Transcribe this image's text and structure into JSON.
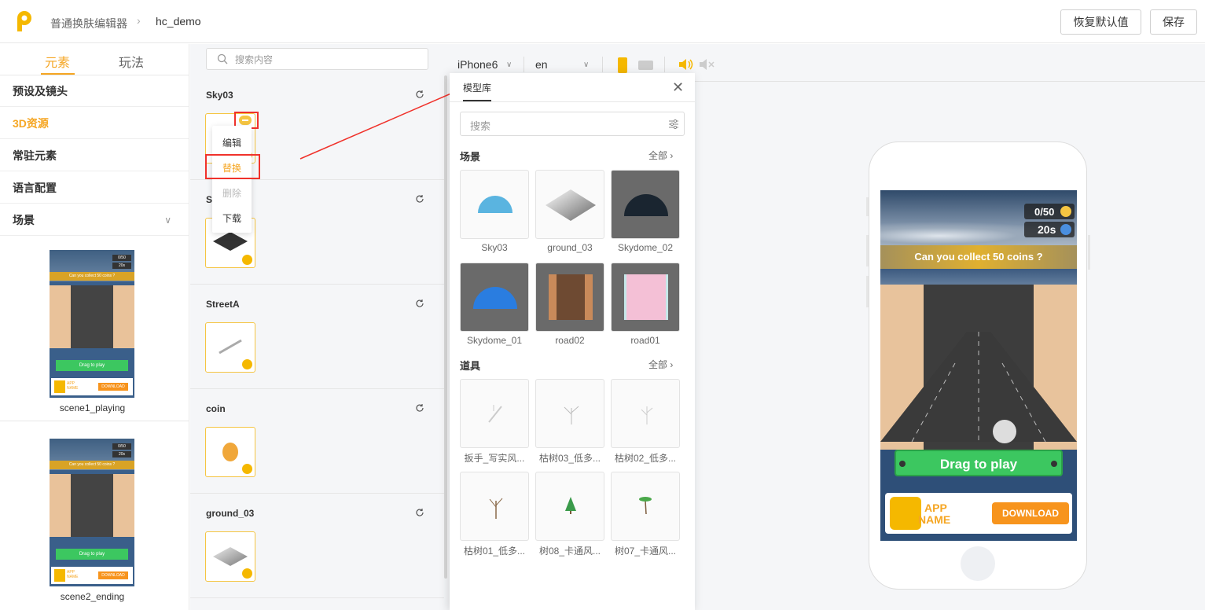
{
  "header": {
    "breadcrumb_root": "普通换肤编辑器",
    "breadcrumb_sep": "›",
    "project": "hc_demo",
    "reset_label": "恢复默认值",
    "save_label": "保存"
  },
  "left_nav": {
    "tabs": [
      "元素",
      "玩法"
    ],
    "items": [
      "预设及镜头",
      "3D资源",
      "常驻元素",
      "语言配置",
      "场景"
    ],
    "scenes": [
      "scene1_playing",
      "scene2_ending"
    ],
    "thumb_texts": {
      "score": "0/50",
      "time": "20s",
      "banner": "Can you collect 50 coins ?",
      "button": "Drag to play",
      "app": "APP NAME",
      "download": "DOWNLOAD"
    }
  },
  "asset_panel": {
    "search_placeholder": "搜索内容",
    "assets": [
      {
        "title": "Sky03"
      },
      {
        "title": "S"
      },
      {
        "title": "StreetA"
      },
      {
        "title": "coin"
      },
      {
        "title": "ground_03"
      }
    ],
    "context_menu": [
      "编辑",
      "替换",
      "删除",
      "下载"
    ]
  },
  "device_bar": {
    "device": "iPhone6",
    "language": "en"
  },
  "model_library": {
    "title": "模型库",
    "search_placeholder": "搜索",
    "scene_section": "场景",
    "prop_section": "道具",
    "all_label": "全部",
    "scene_items": [
      "Sky03",
      "ground_03",
      "Skydome_02",
      "Skydome_01",
      "road02",
      "road01"
    ],
    "prop_items": [
      "扳手_写实风...",
      "枯树03_低多...",
      "枯树02_低多...",
      "枯树01_低多...",
      "树08_卡通风...",
      "树07_卡通风..."
    ]
  },
  "preview": {
    "score": "0/50",
    "time": "20s",
    "banner": "Can you collect 50 coins ?",
    "play_button": "Drag to play",
    "app_line1": "APP",
    "app_line2": "NAME",
    "download": "DOWNLOAD"
  },
  "colors": {
    "accent": "#f5a623",
    "highlight_red": "#f0322b",
    "play_green": "#3cc760",
    "download_orange": "#f7941d"
  }
}
